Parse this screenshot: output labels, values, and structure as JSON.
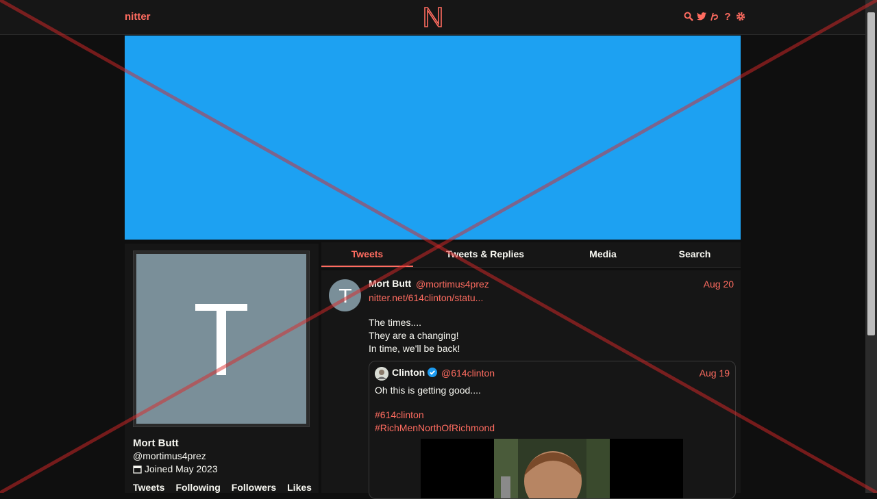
{
  "nav": {
    "brand": "nitter",
    "icons": [
      "search-icon",
      "twitter-bird-icon",
      "rss-icon",
      "help-icon",
      "settings-icon"
    ]
  },
  "colors": {
    "accent": "#ff6c60",
    "banner": "#1da1f2",
    "avatar_bg": "#7a8f99"
  },
  "profile": {
    "avatar_letter": "T",
    "fullname": "Mort Butt",
    "username": "@mortimus4prez",
    "joined": "Joined May 2023",
    "stats": [
      "Tweets",
      "Following",
      "Followers",
      "Likes"
    ]
  },
  "tabs": [
    {
      "label": "Tweets",
      "active": true
    },
    {
      "label": "Tweets & Replies",
      "active": false
    },
    {
      "label": "Media",
      "active": false
    },
    {
      "label": "Search",
      "active": false
    }
  ],
  "tweet": {
    "avatar_letter": "T",
    "fullname": "Mort Butt",
    "username": "@mortimus4prez",
    "date": "Aug 20",
    "link": "nitter.net/614clinton/statu...",
    "lines": [
      "The times....",
      "They are a changing!",
      "In time, we'll be back!"
    ],
    "quote": {
      "fullname": "Clinton",
      "verified": true,
      "username": "@614clinton",
      "date": "Aug 19",
      "text": "Oh this is getting good....",
      "hashtags": [
        "#614clinton",
        "#RichMenNorthOfRichmond"
      ]
    }
  }
}
